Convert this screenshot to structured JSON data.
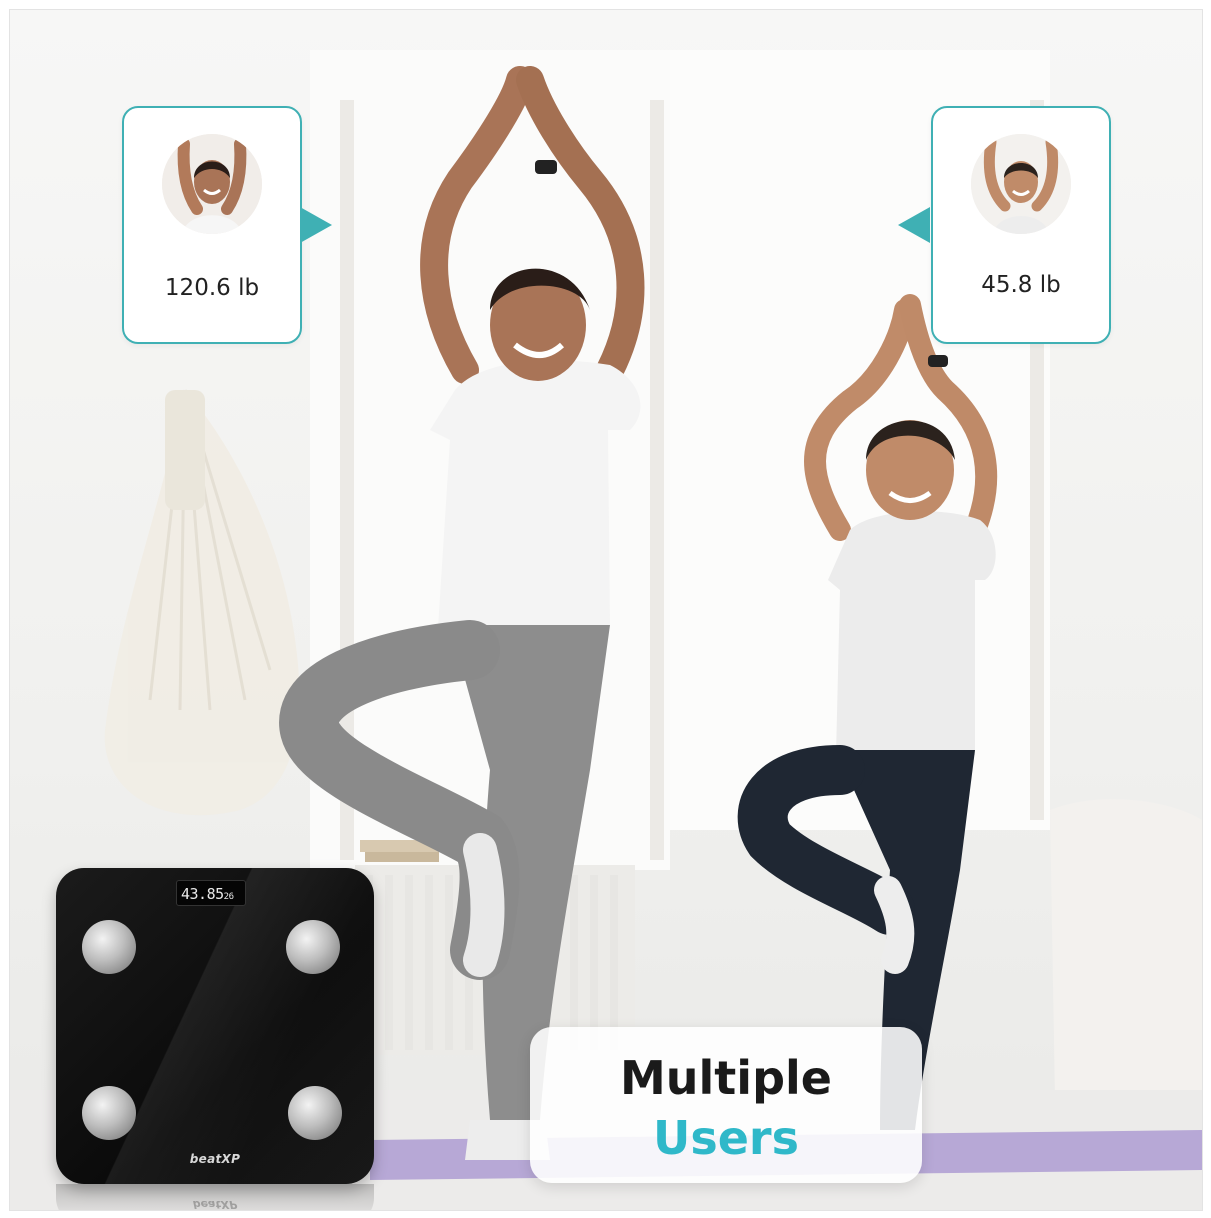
{
  "users": [
    {
      "weight": "120.6 lb",
      "avatar": "woman-portrait"
    },
    {
      "weight": "45.8 lb",
      "avatar": "boy-portrait"
    }
  ],
  "scale": {
    "display_main": "43.85",
    "display_small": "26",
    "brand": "beatXP"
  },
  "caption": {
    "line1": "Multiple",
    "line2": "Users"
  },
  "colors": {
    "accent_teal": "#3fb0b4",
    "caption_highlight": "#2fb8c9"
  }
}
